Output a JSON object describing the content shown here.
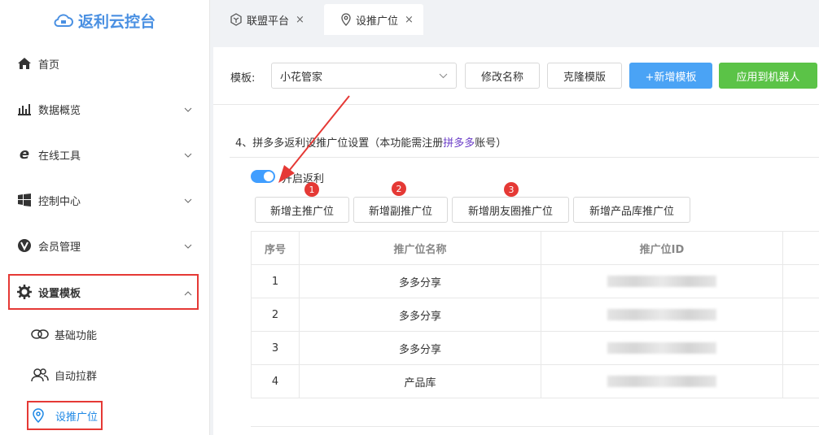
{
  "sidebar": {
    "logo": "返利云控台",
    "items": [
      {
        "label": "首页"
      },
      {
        "label": "数据概览"
      },
      {
        "label": "在线工具"
      },
      {
        "label": "控制中心"
      },
      {
        "label": "会员管理"
      },
      {
        "label": "设置模板"
      }
    ],
    "sub_items": [
      {
        "label": "基础功能"
      },
      {
        "label": "自动拉群"
      },
      {
        "label": "设推广位"
      }
    ]
  },
  "tabs": [
    {
      "label": "联盟平台",
      "close": "×"
    },
    {
      "label": "设推广位",
      "close": "×"
    }
  ],
  "toolbar": {
    "template_label": "模板:",
    "template_value": "小花管家",
    "rename": "修改名称",
    "clone": "克隆模版",
    "add": "+新增模板",
    "apply": "应用到机器人"
  },
  "section": {
    "title_pre": "4、拼多多返利设推广位设置（本功能需注册",
    "title_accent": "拼多多",
    "title_post": "账号）",
    "toggle_label": "开启返利",
    "toggle_on": true
  },
  "badges": [
    "1",
    "2",
    "3"
  ],
  "actions": {
    "add_main": "新增主推广位",
    "add_sub": "新增副推广位",
    "add_moments": "新增朋友圈推广位",
    "add_library": "新增产品库推广位"
  },
  "table": {
    "headers": [
      "序号",
      "推广位名称",
      "推广位ID"
    ],
    "rows": [
      {
        "no": "1",
        "name": "多多分享"
      },
      {
        "no": "2",
        "name": "多多分享"
      },
      {
        "no": "3",
        "name": "多多分享"
      },
      {
        "no": "4",
        "name": "产品库"
      }
    ]
  },
  "colors": {
    "accent": "#4a90e2",
    "primary_button": "#4aa3f5",
    "success_button": "#5bc347",
    "highlight_box": "#e53935",
    "toggle": "#409eff"
  }
}
